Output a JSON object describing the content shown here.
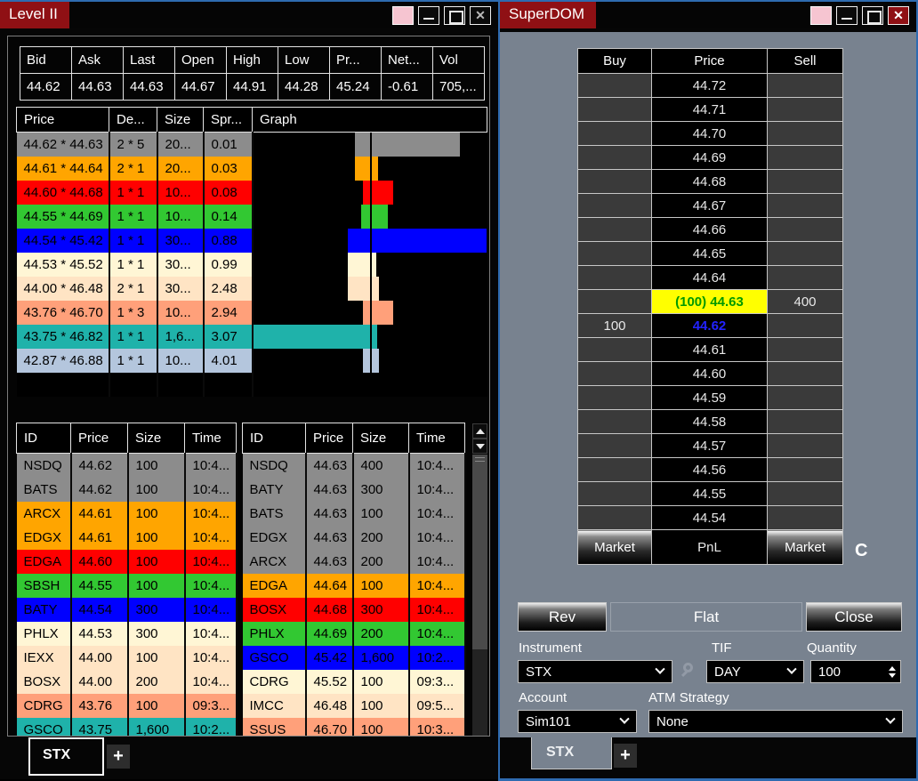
{
  "colors": {
    "accent_blue": "#2E6BB0",
    "title_red": "#8F1014",
    "slate_panel": "#78828F",
    "inside_ask_highlight": "#FFFF00",
    "inside_ask_text": "#009900",
    "last_price_text": "#2222FF"
  },
  "level2": {
    "title": "Level II",
    "quote": {
      "headers": [
        "Bid",
        "Ask",
        "Last",
        "Open",
        "High",
        "Low",
        "Pr...",
        "Net...",
        "Vol"
      ],
      "values": [
        "44.62",
        "44.63",
        "44.63",
        "44.67",
        "44.91",
        "44.28",
        "45.24",
        "-0.61",
        "705,..."
      ]
    },
    "ladder": {
      "headers": [
        "Price",
        "De...",
        "Size",
        "Spr...",
        "Graph"
      ],
      "rows": [
        {
          "price": "44.62 * 44.63",
          "depth": "2 * 5",
          "size": "20...",
          "spread": "0.01",
          "color": "#8C8C8C",
          "bid_pct": 13,
          "ask_pct": 77
        },
        {
          "price": "44.61 * 44.64",
          "depth": "2 * 1",
          "size": "20...",
          "spread": "0.03",
          "color": "#FFA500",
          "bid_pct": 13,
          "ask_pct": 7
        },
        {
          "price": "44.60 * 44.68",
          "depth": "1 * 1",
          "size": "10...",
          "spread": "0.08",
          "color": "#FF0000",
          "bid_pct": 6,
          "ask_pct": 20
        },
        {
          "price": "44.55 * 44.69",
          "depth": "1 * 1",
          "size": "10...",
          "spread": "0.14",
          "color": "#32C832",
          "bid_pct": 8,
          "ask_pct": 15
        },
        {
          "price": "44.54 * 45.42",
          "depth": "1 * 1",
          "size": "30...",
          "spread": "0.88",
          "color": "#0000FF",
          "bid_pct": 19,
          "ask_pct": 100
        },
        {
          "price": "44.53 * 45.52",
          "depth": "1 * 1",
          "size": "30...",
          "spread": "0.99",
          "color": "#FFF6D5",
          "bid_pct": 19,
          "ask_pct": 5
        },
        {
          "price": "44.00 * 46.48",
          "depth": "2 * 1",
          "size": "30...",
          "spread": "2.48",
          "color": "#FFE4C4",
          "bid_pct": 19,
          "ask_pct": 8
        },
        {
          "price": "43.76 * 46.70",
          "depth": "1 * 3",
          "size": "10...",
          "spread": "2.94",
          "color": "#FFA07A",
          "bid_pct": 6,
          "ask_pct": 20
        },
        {
          "price": "43.75 * 46.82",
          "depth": "1 * 1",
          "size": "1,6...",
          "spread": "3.07",
          "color": "#1FB2AA",
          "bid_pct": 100,
          "ask_pct": 6
        },
        {
          "price": "42.87 * 46.88",
          "depth": "1 * 1",
          "size": "10...",
          "spread": "4.01",
          "color": "#B4C6DD",
          "bid_pct": 6,
          "ask_pct": 8
        }
      ]
    },
    "tns_left": {
      "headers": [
        "ID",
        "Price",
        "Size",
        "Time"
      ],
      "rows": [
        {
          "id": "NSDQ",
          "price": "44.62",
          "size": "100",
          "time": "10:4...",
          "color": "#8C8C8C"
        },
        {
          "id": "BATS",
          "price": "44.62",
          "size": "100",
          "time": "10:4...",
          "color": "#8C8C8C"
        },
        {
          "id": "ARCX",
          "price": "44.61",
          "size": "100",
          "time": "10:4...",
          "color": "#FFA500"
        },
        {
          "id": "EDGX",
          "price": "44.61",
          "size": "100",
          "time": "10:4...",
          "color": "#FFA500"
        },
        {
          "id": "EDGA",
          "price": "44.60",
          "size": "100",
          "time": "10:4...",
          "color": "#FF0000"
        },
        {
          "id": "SBSH",
          "price": "44.55",
          "size": "100",
          "time": "10:4...",
          "color": "#32C832"
        },
        {
          "id": "BATY",
          "price": "44.54",
          "size": "300",
          "time": "10:4...",
          "color": "#0000FF"
        },
        {
          "id": "PHLX",
          "price": "44.53",
          "size": "300",
          "time": "10:4...",
          "color": "#FFF6D5"
        },
        {
          "id": "IEXX",
          "price": "44.00",
          "size": "100",
          "time": "10:4...",
          "color": "#FFE4C4"
        },
        {
          "id": "BOSX",
          "price": "44.00",
          "size": "200",
          "time": "10:4...",
          "color": "#FFE4C4"
        },
        {
          "id": "CDRG",
          "price": "43.76",
          "size": "100",
          "time": "09:3...",
          "color": "#FFA07A"
        },
        {
          "id": "GSCO",
          "price": "43.75",
          "size": "1,600",
          "time": "10:2...",
          "color": "#1FB2AA"
        }
      ]
    },
    "tns_right": {
      "headers": [
        "ID",
        "Price",
        "Size",
        "Time"
      ],
      "rows": [
        {
          "id": "NSDQ",
          "price": "44.63",
          "size": "400",
          "time": "10:4...",
          "color": "#8C8C8C"
        },
        {
          "id": "BATY",
          "price": "44.63",
          "size": "300",
          "time": "10:4...",
          "color": "#8C8C8C"
        },
        {
          "id": "BATS",
          "price": "44.63",
          "size": "100",
          "time": "10:4...",
          "color": "#8C8C8C"
        },
        {
          "id": "EDGX",
          "price": "44.63",
          "size": "200",
          "time": "10:4...",
          "color": "#8C8C8C"
        },
        {
          "id": "ARCX",
          "price": "44.63",
          "size": "200",
          "time": "10:4...",
          "color": "#8C8C8C"
        },
        {
          "id": "EDGA",
          "price": "44.64",
          "size": "100",
          "time": "10:4...",
          "color": "#FFA500"
        },
        {
          "id": "BOSX",
          "price": "44.68",
          "size": "300",
          "time": "10:4...",
          "color": "#FF0000"
        },
        {
          "id": "PHLX",
          "price": "44.69",
          "size": "200",
          "time": "10:4...",
          "color": "#32C832"
        },
        {
          "id": "GSCO",
          "price": "45.42",
          "size": "1,600",
          "time": "10:2...",
          "color": "#0000FF"
        },
        {
          "id": "CDRG",
          "price": "45.52",
          "size": "100",
          "time": "09:3...",
          "color": "#FFF6D5"
        },
        {
          "id": "IMCC",
          "price": "46.48",
          "size": "100",
          "time": "09:5...",
          "color": "#FFE4C4"
        },
        {
          "id": "SSUS",
          "price": "46.70",
          "size": "100",
          "time": "10:3...",
          "color": "#FFA07A"
        }
      ]
    },
    "tab": "STX",
    "add_tab": "+"
  },
  "superdom": {
    "title": "SuperDOM",
    "dom": {
      "headers": [
        "Buy",
        "Price",
        "Sell"
      ],
      "rows": [
        {
          "buy": "",
          "price": "44.72",
          "sell": ""
        },
        {
          "buy": "",
          "price": "44.71",
          "sell": ""
        },
        {
          "buy": "",
          "price": "44.70",
          "sell": ""
        },
        {
          "buy": "",
          "price": "44.69",
          "sell": ""
        },
        {
          "buy": "",
          "price": "44.68",
          "sell": ""
        },
        {
          "buy": "",
          "price": "44.67",
          "sell": ""
        },
        {
          "buy": "",
          "price": "44.66",
          "sell": ""
        },
        {
          "buy": "",
          "price": "44.65",
          "sell": ""
        },
        {
          "buy": "",
          "price": "44.64",
          "sell": ""
        },
        {
          "buy": "",
          "price": "(100) 44.63",
          "sell": "400",
          "highlight": "yellow"
        },
        {
          "buy": "100",
          "price": "44.62",
          "sell": "",
          "highlight": "blue"
        },
        {
          "buy": "",
          "price": "44.61",
          "sell": ""
        },
        {
          "buy": "",
          "price": "44.60",
          "sell": ""
        },
        {
          "buy": "",
          "price": "44.59",
          "sell": ""
        },
        {
          "buy": "",
          "price": "44.58",
          "sell": ""
        },
        {
          "buy": "",
          "price": "44.57",
          "sell": ""
        },
        {
          "buy": "",
          "price": "44.56",
          "sell": ""
        },
        {
          "buy": "",
          "price": "44.55",
          "sell": ""
        },
        {
          "buy": "",
          "price": "44.54",
          "sell": ""
        }
      ],
      "market_label": "Market",
      "pnl_label": "PnL",
      "center_button": "C"
    },
    "actions": {
      "rev": "Rev",
      "flat": "Flat",
      "close": "Close"
    },
    "form": {
      "instrument_label": "Instrument",
      "instrument_value": "STX",
      "tif_label": "TIF",
      "tif_value": "DAY",
      "quantity_label": "Quantity",
      "quantity_value": "100",
      "account_label": "Account",
      "account_value": "Sim101",
      "atm_label": "ATM Strategy",
      "atm_value": "None"
    },
    "tab": "STX",
    "add_tab": "+"
  }
}
